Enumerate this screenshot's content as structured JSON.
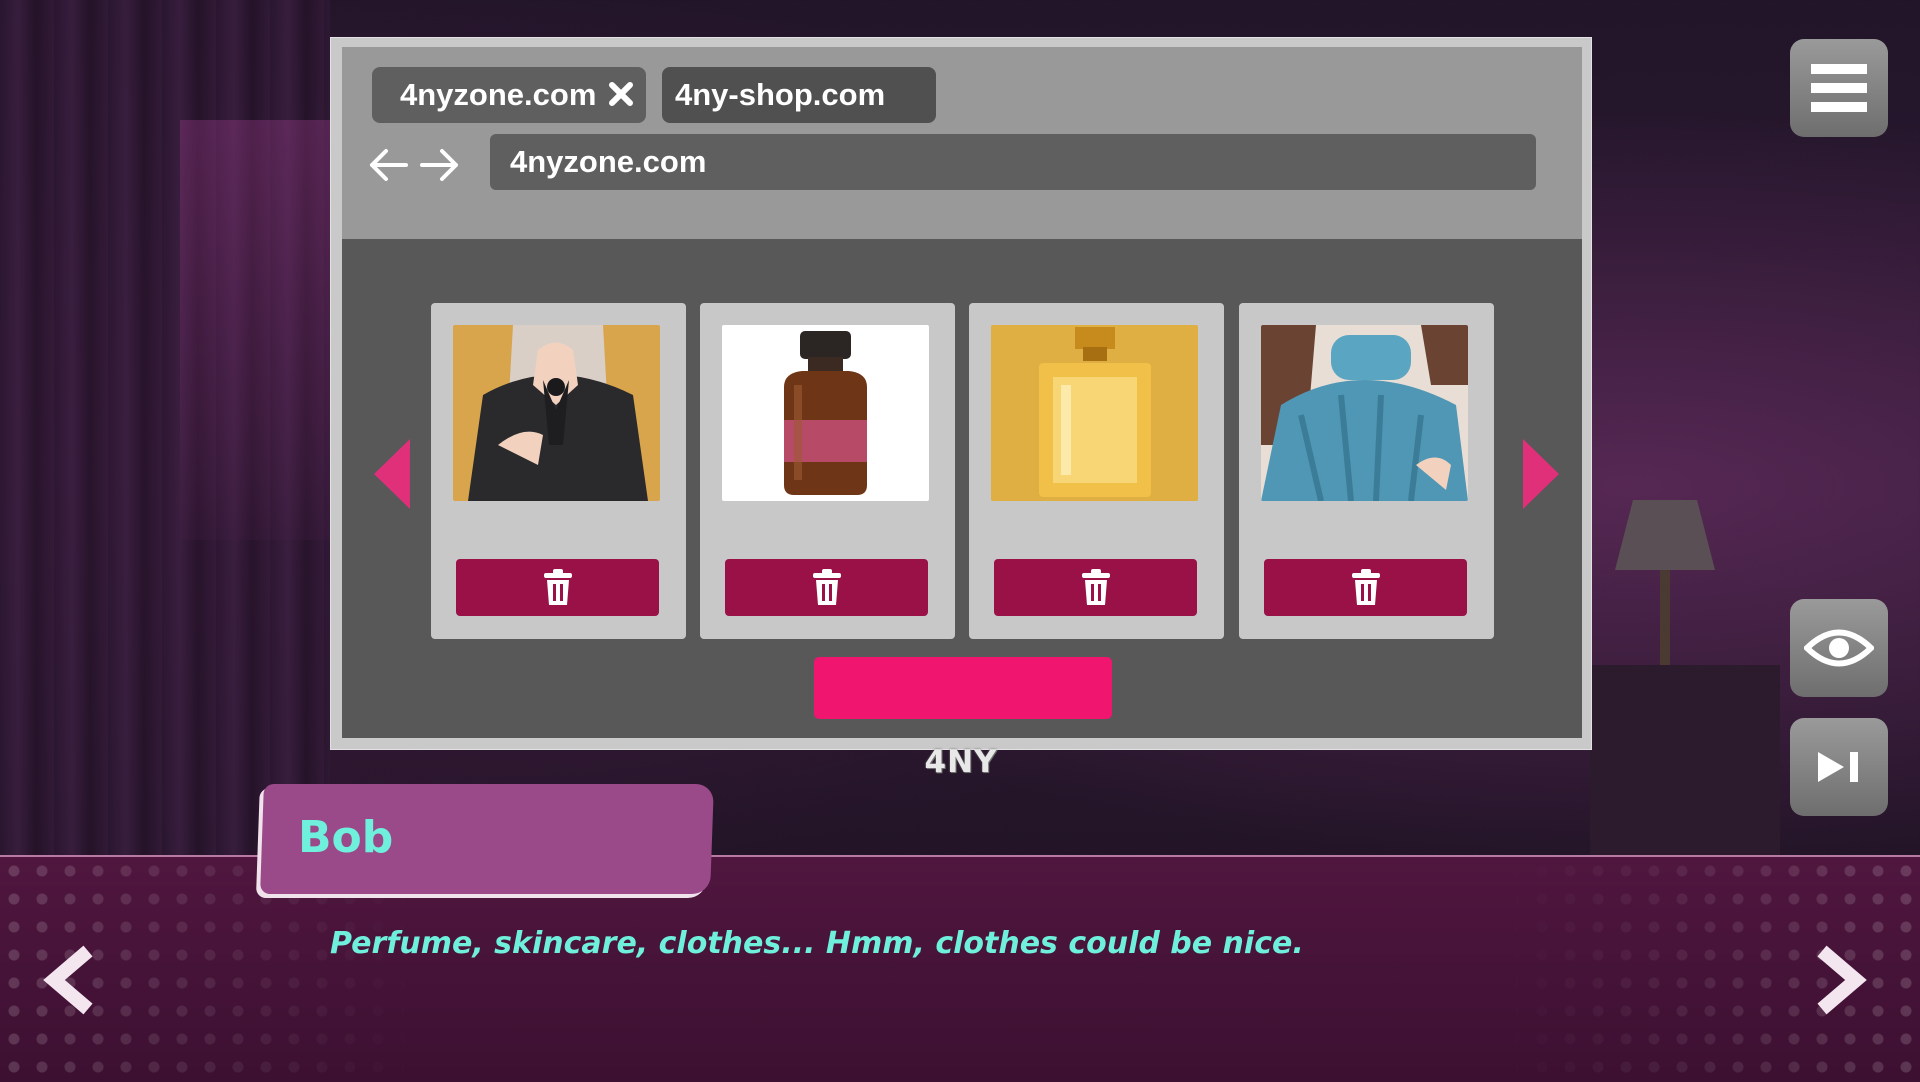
{
  "browser": {
    "tabs": [
      {
        "label": "4nyzone.com",
        "active": true
      },
      {
        "label": "4ny-shop.com",
        "active": false
      }
    ],
    "url": "4nyzone.com",
    "monitor_brand": "4NY"
  },
  "shop": {
    "items": [
      {
        "name": "black blouse",
        "image": "black-blouse"
      },
      {
        "name": "amber bottle",
        "image": "amber-bottle"
      },
      {
        "name": "perfume",
        "image": "perfume-bottle"
      },
      {
        "name": "blue sweater",
        "image": "blue-sweater"
      }
    ],
    "delete_icon": "trash-icon",
    "accent": "#f0156e",
    "delete_color": "#9a1147"
  },
  "dialogue": {
    "speaker": "Bob",
    "text": "Perfume, skincare, clothes... Hmm, clothes could be nice.",
    "name_color": "#6ef0dc"
  },
  "controls": [
    "menu-icon",
    "eye-icon",
    "skip-icon",
    "back-icon",
    "forward-icon"
  ]
}
